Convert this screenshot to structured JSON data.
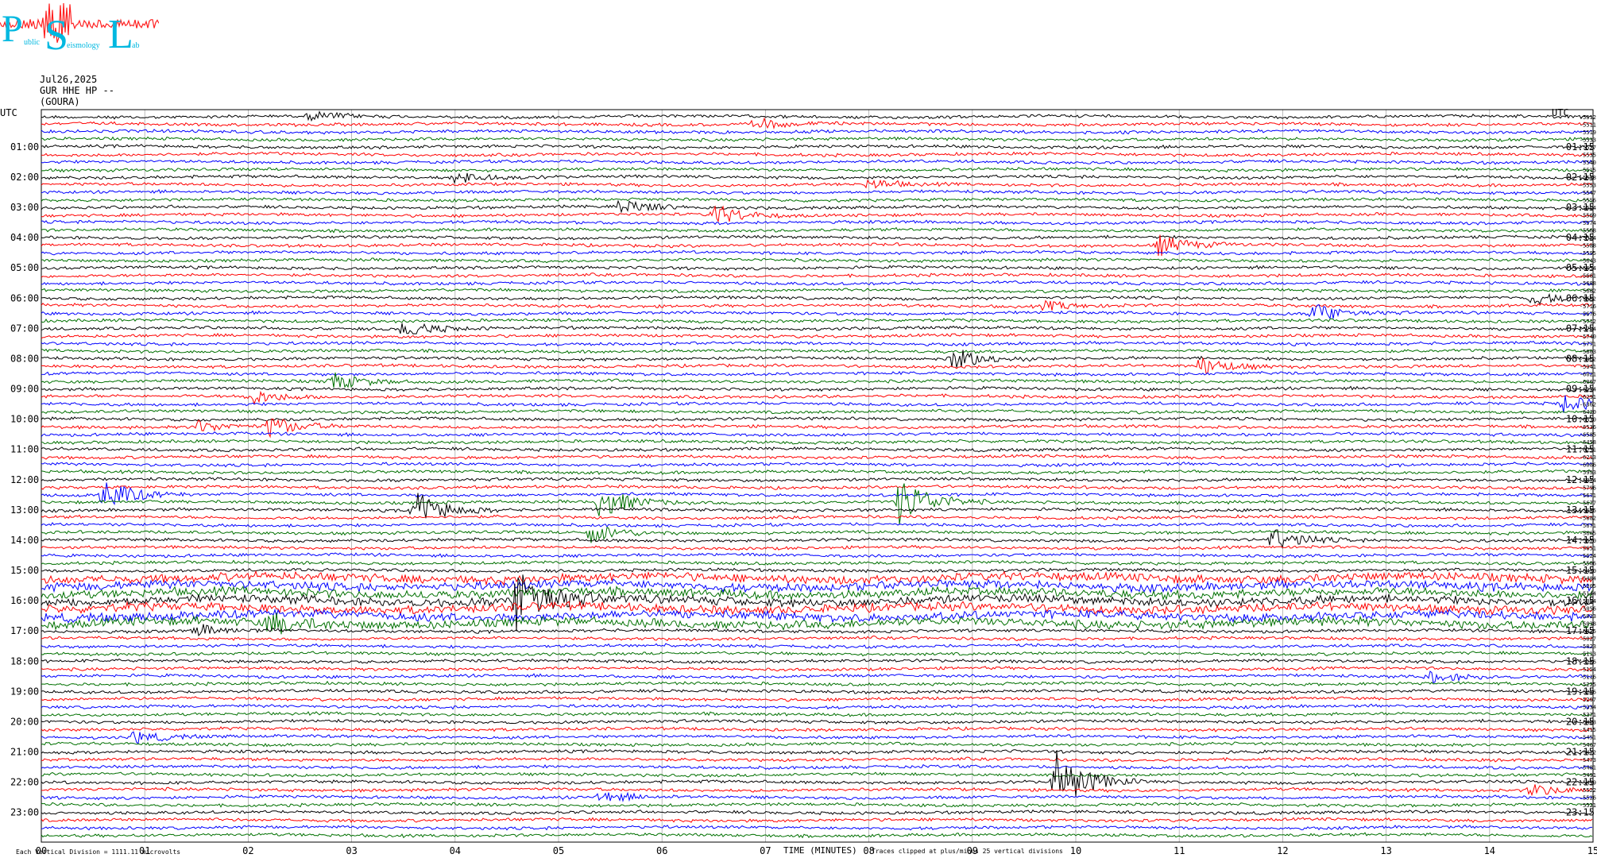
{
  "logo": {
    "big_letters": [
      "P",
      "S",
      "L"
    ],
    "small_text": [
      "ublic",
      "eismology",
      "ab"
    ]
  },
  "header": {
    "date": "Jul26,2025",
    "channel": "GUR HHE HP --",
    "station": "(GOURA)"
  },
  "chart_data": {
    "type": "line",
    "title": "",
    "xlabel": "TIME (MINUTES)",
    "ylabel": "",
    "xlim": [
      0,
      15
    ],
    "x_ticks": [
      "00",
      "01",
      "02",
      "03",
      "04",
      "05",
      "06",
      "07",
      "08",
      "09",
      "10",
      "11",
      "12",
      "13",
      "14",
      "15"
    ],
    "left_axis_title": "UTC",
    "right_axis_title": "UTC",
    "left_hour_labels": [
      "01:00",
      "02:00",
      "03:00",
      "04:00",
      "05:00",
      "06:00",
      "07:00",
      "08:00",
      "09:00",
      "10:00",
      "11:00",
      "12:00",
      "13:00",
      "14:00",
      "15:00",
      "16:00",
      "17:00",
      "18:00",
      "19:00",
      "20:00",
      "21:00",
      "22:00",
      "23:00"
    ],
    "right_hour_labels": [
      "01:15",
      "02:15",
      "03:15",
      "04:15",
      "05:15",
      "06:15",
      "07:15",
      "08:15",
      "09:15",
      "10:15",
      "11:15",
      "12:15",
      "13:15",
      "14:15",
      "15:15",
      "16:15",
      "17:15",
      "18:15",
      "19:15",
      "20:15",
      "21:15",
      "22:15",
      "23:15"
    ],
    "trace_colors": [
      "#000000",
      "#ff0000",
      "#0000ff",
      "#007000"
    ],
    "trace_count": 96,
    "right_offsets": [
      "-5512",
      "-5511",
      "-5519",
      "-5533",
      "-5527",
      "-5535",
      "-5540",
      "-5515",
      "-5548",
      "-5553",
      "-5547",
      "-5556",
      "-5564",
      "-5569",
      "-5574",
      "-5568",
      "-5584",
      "-5588",
      "-5595",
      "-5643",
      "-5654",
      "-5661",
      "-5688",
      "-5682",
      "-5662",
      "-5716",
      "-5676",
      "-5712",
      "-5704",
      "-5740",
      "-5771",
      "-5803",
      "-5862",
      "-5941",
      "-6021",
      "-6067",
      "-6134",
      "-6291",
      "-6362",
      "-6420",
      "-6530",
      "-6536",
      "-6585",
      "-6458",
      "-6251",
      "-6213",
      "-6086",
      "-5953",
      "-5874",
      "-5796",
      "-5671",
      "-5677",
      "-5655",
      "-5682",
      "-5671",
      "-5665",
      "-5670",
      "-5651",
      "-5624",
      "-5506",
      "-5430",
      "-5484",
      "-5205",
      "-5144",
      "-5064",
      "-5056",
      "-5013",
      "-5038",
      "-5025",
      "-5027",
      "-5023",
      "-5113",
      "-5186",
      "-5154",
      "-5116",
      "-5225",
      "-5266",
      "-5207",
      "-5334",
      "-5371",
      "-5403",
      "-5415",
      "-5451",
      "-5467",
      "-5472",
      "-5473",
      "-5481",
      "-5491",
      "-5499",
      "-5522",
      "-5526",
      "-5521"
    ],
    "events": [
      {
        "trace": 0,
        "minute": 2.6,
        "amp": 1.2
      },
      {
        "trace": 1,
        "minute": 6.9,
        "amp": 1.5
      },
      {
        "trace": 8,
        "minute": 4.0,
        "amp": 1.6
      },
      {
        "trace": 9,
        "minute": 8.0,
        "amp": 1.2
      },
      {
        "trace": 12,
        "minute": 5.6,
        "amp": 2.0
      },
      {
        "trace": 13,
        "minute": 6.5,
        "amp": 2.5
      },
      {
        "trace": 17,
        "minute": 10.8,
        "amp": 2.5
      },
      {
        "trace": 24,
        "minute": 14.4,
        "amp": 1.5
      },
      {
        "trace": 25,
        "minute": 9.7,
        "amp": 1.2
      },
      {
        "trace": 26,
        "minute": 12.3,
        "amp": 2.5
      },
      {
        "trace": 28,
        "minute": 3.5,
        "amp": 2.0
      },
      {
        "trace": 32,
        "minute": 8.8,
        "amp": 3.0
      },
      {
        "trace": 33,
        "minute": 11.2,
        "amp": 2.2
      },
      {
        "trace": 35,
        "minute": 2.8,
        "amp": 2.2
      },
      {
        "trace": 37,
        "minute": 2.0,
        "amp": 2.0
      },
      {
        "trace": 38,
        "minute": 14.7,
        "amp": 2.5
      },
      {
        "trace": 41,
        "minute": 2.2,
        "amp": 2.5
      },
      {
        "trace": 41,
        "minute": 1.5,
        "amp": 1.5
      },
      {
        "trace": 52,
        "minute": 3.6,
        "amp": 5.0
      },
      {
        "trace": 51,
        "minute": 5.4,
        "amp": 4.0
      },
      {
        "trace": 51,
        "minute": 8.3,
        "amp": 6.0
      },
      {
        "trace": 50,
        "minute": 0.6,
        "amp": 4.0
      },
      {
        "trace": 55,
        "minute": 5.3,
        "amp": 2.5
      },
      {
        "trace": 56,
        "minute": 11.9,
        "amp": 3.0
      },
      {
        "trace": 64,
        "minute": 4.6,
        "amp": 9.0
      },
      {
        "trace": 67,
        "minute": 2.2,
        "amp": 2.5
      },
      {
        "trace": 68,
        "minute": 1.5,
        "amp": 1.5
      },
      {
        "trace": 74,
        "minute": 13.4,
        "amp": 1.5
      },
      {
        "trace": 82,
        "minute": 0.9,
        "amp": 1.5
      },
      {
        "trace": 88,
        "minute": 9.8,
        "amp": 8.0
      },
      {
        "trace": 89,
        "minute": 14.4,
        "amp": 1.5
      },
      {
        "trace": 90,
        "minute": 5.4,
        "amp": 1.5
      }
    ],
    "busy_traces": [
      61,
      62,
      63,
      64,
      65,
      66,
      67
    ],
    "footer_left": "Each Vertical Division = 1111.11 microvolts",
    "footer_right": "Traces clipped at plus/minus 25 vertical divisions",
    "grid": true
  }
}
